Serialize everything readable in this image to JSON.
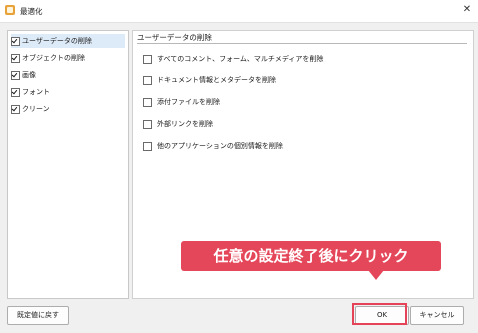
{
  "window": {
    "title": "最適化",
    "close_glyph": "✕"
  },
  "sidebar": {
    "items": [
      {
        "label": "ユーザーデータの削除",
        "checked": true,
        "selected": true
      },
      {
        "label": "オブジェクトの削除",
        "checked": true,
        "selected": false
      },
      {
        "label": "画像",
        "checked": true,
        "selected": false
      },
      {
        "label": "フォント",
        "checked": true,
        "selected": false
      },
      {
        "label": "クリーン",
        "checked": true,
        "selected": false
      }
    ]
  },
  "panel": {
    "title": "ユーザーデータの削除",
    "options": [
      {
        "label": "すべてのコメント、フォーム、マルチメディアを削除",
        "checked": false
      },
      {
        "label": "ドキュメント情報とメタデータを削除",
        "checked": false
      },
      {
        "label": "添付ファイルを削除",
        "checked": false
      },
      {
        "label": "外部リンクを削除",
        "checked": false
      },
      {
        "label": "他のアプリケーションの個別情報を削除",
        "checked": false
      }
    ]
  },
  "footer": {
    "reset_label": "既定値に戻す",
    "ok_label": "OK",
    "cancel_label": "キャンセル"
  },
  "callout": {
    "text": "任意の設定終了後にクリック"
  },
  "colors": {
    "accent": "#e5475a",
    "selection": "#ddeaf8"
  }
}
